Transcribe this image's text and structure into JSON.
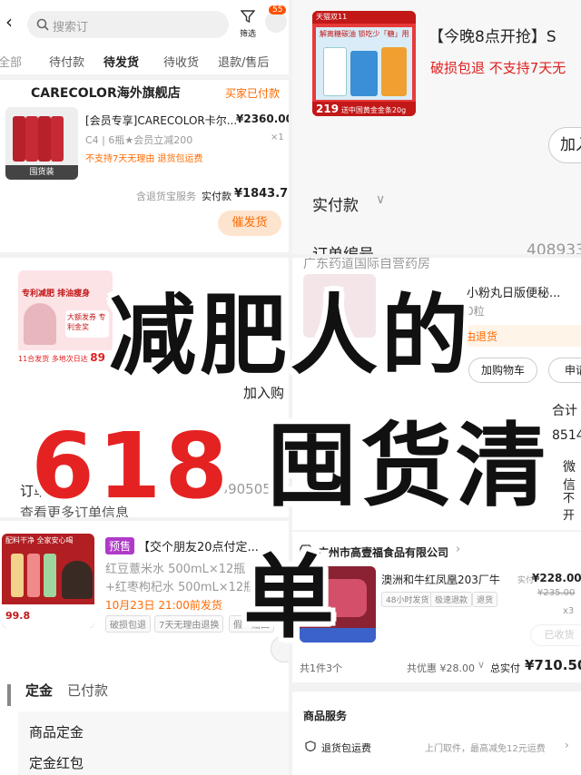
{
  "top_left": {
    "search_placeholder": "搜索订",
    "filter_label": "筛选",
    "notif_count": "55",
    "tabs": [
      "全部",
      "待付款",
      "待发货",
      "待收货",
      "退款/售后"
    ],
    "store_name": "CARECOLOR海外旗舰店",
    "store_status": "买家已付款",
    "product_title": "[会员专享]CARECOLOR卡尔...",
    "product_price": "¥2360.00",
    "product_spec": "C4 | 6瓶★会员立减200",
    "product_qty": "×1",
    "product_tags": "不支持7天无理由  退货包运费",
    "thumb_label": "囤货装",
    "service_label": "含退货宝服务",
    "paid_label": "实付款",
    "paid_amount": "¥1843.78",
    "action_button": "催发货"
  },
  "top_right": {
    "banner_badge": "天猫双11",
    "banner_slogan": "解离糖碳油 锁吃少「糖」用",
    "banner_price": "219",
    "banner_note": "送中国黄金金条20g",
    "promo_title": "【今晚8点开抢】S",
    "promo_tags": "破损包退  不支持7天无",
    "add_label": "加入",
    "paid_label": "实付款",
    "order_label": "订单编号",
    "order_number": "408933"
  },
  "mid_left": {
    "thumb_tag": "专利减肥 排油瘦身",
    "thumb_promo": "大额发券 专利金奖",
    "thumb_footer": "11合发货 多地次日达",
    "thumb_price": "89",
    "add_cart_partial": "加入购",
    "order_label": "订单编号",
    "order_number": "4390505",
    "more_info": "查看更多订单信息"
  },
  "mid_right": {
    "store_partial": "广东药道国际自营药房",
    "product_title": "小粉丸日版便秘...",
    "qty_partial": "0粒",
    "refund_tag": "由退货",
    "add_cart_button": "加购物车",
    "apply_button": "申请",
    "total_label": "合计",
    "order_partial": "8514",
    "wechat_partial": "微信",
    "invoice_label": "发票类型",
    "invoice_value": "不开"
  },
  "bottom_left": {
    "thumb_line1": "配料干净 全家安心喝",
    "thumb_sale_price": "99.8",
    "presale_badge": "预售",
    "product_title": "【交个朋友20点付定...",
    "spec_line1": "红豆薏米水 500mL×12瓶",
    "spec_line2": "+红枣枸杞水 500mL×12瓶",
    "ship_date": "10月23日 21:00前发货",
    "tags": [
      "破损包退",
      "7天无理由退换",
      "假一赔四"
    ],
    "deposit_label": "定金",
    "deposit_status": "已付款",
    "item_deposit": "商品定金",
    "deposit_red_packet": "定金红包"
  },
  "bottom_right": {
    "store_name": "广州市高壹福食品有限公司",
    "product_title": "澳洲和牛红凤凰203厂牛",
    "paid_prefix": "实付",
    "paid_price": "¥228.00",
    "orig_price": "¥235.00",
    "ship_tags": [
      "48小时发货",
      "极速退款",
      "退货"
    ],
    "qty": "x3",
    "received_button": "已收货",
    "count_label": "共1件3个",
    "discount_label": "共优惠 ¥28.00",
    "total_label": "总实付",
    "total_amount": "¥710.50",
    "section_title": "商品服务",
    "service_name": "退货包运费",
    "service_desc": "上门取件，最高减免12元运费"
  },
  "overlay": {
    "line1": "减肥人的",
    "line2_num": "618",
    "line2_text": "囤货清单"
  },
  "colors": {
    "accent_orange": "#ff6a00",
    "accent_red": "#e02020",
    "title_red": "#e52222"
  }
}
